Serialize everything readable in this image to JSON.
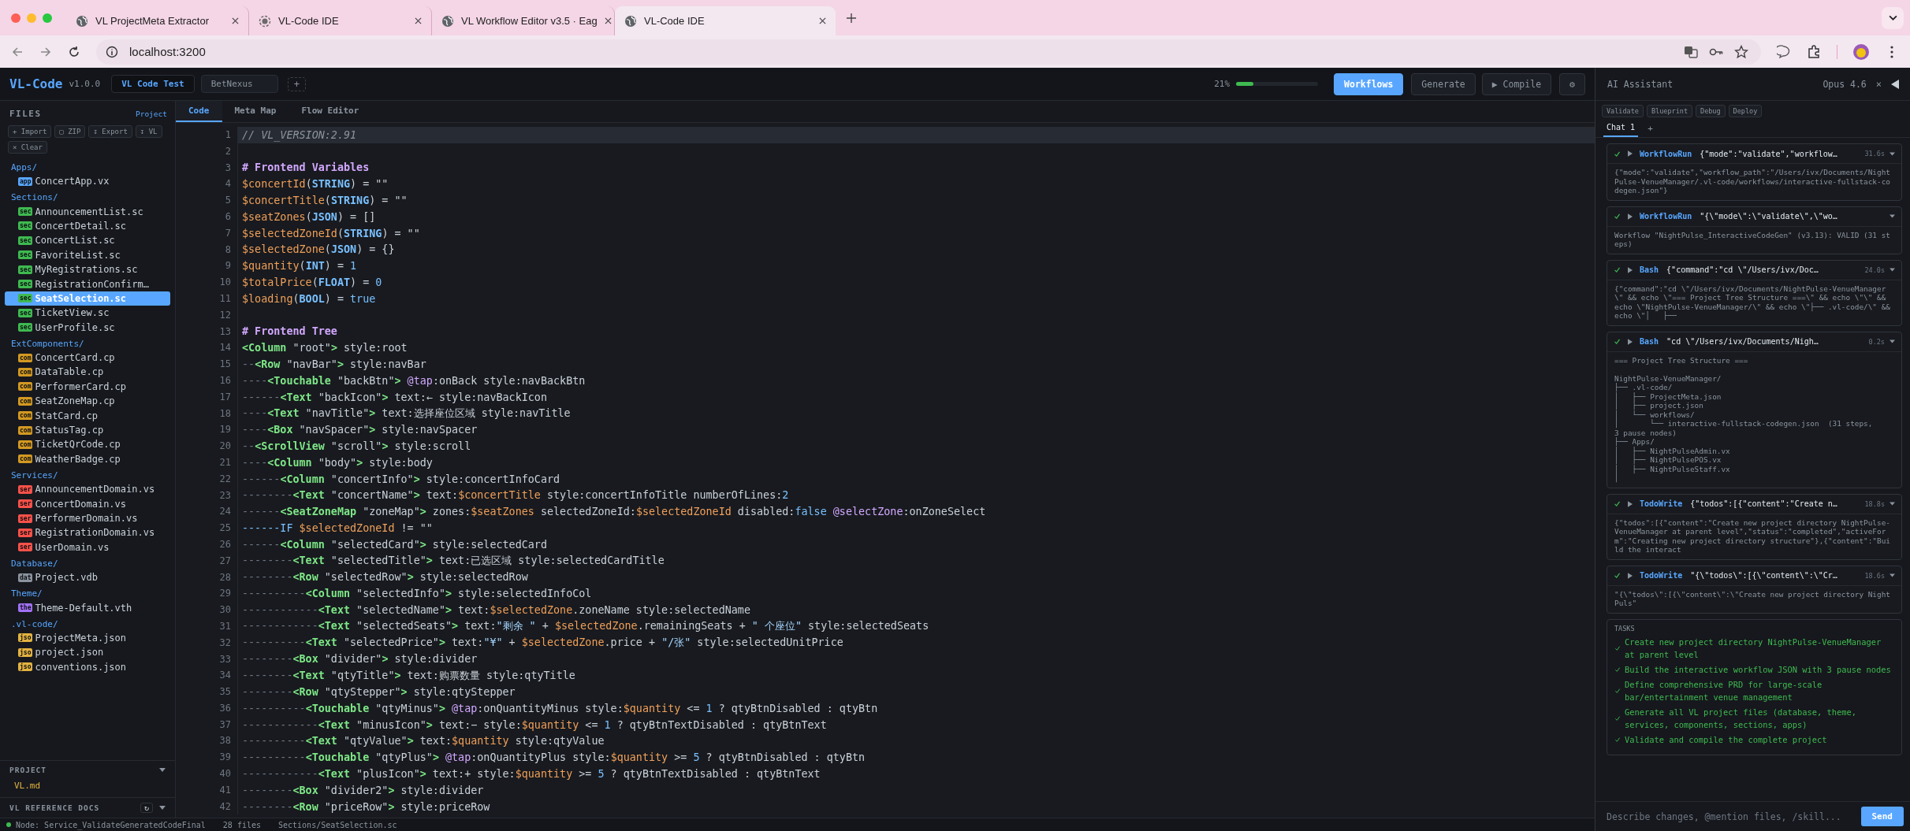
{
  "browser": {
    "tabs": [
      {
        "title": "VL ProjectMeta Extractor",
        "loading": false,
        "selected": false
      },
      {
        "title": "VL-Code IDE",
        "loading": true,
        "selected": false
      },
      {
        "title": "VL Workflow Editor v3.5 · Eag",
        "loading": false,
        "selected": false
      },
      {
        "title": "VL-Code IDE",
        "loading": false,
        "selected": true
      }
    ],
    "address": "localhost:3200"
  },
  "header": {
    "logo": "VL-Code",
    "version": "v1.0.0",
    "project_tabs": [
      {
        "label": "VL Code Test",
        "selected": true
      },
      {
        "label": "BetNexus",
        "selected": false
      }
    ],
    "add_project": "+",
    "progress": {
      "reading": "21%",
      "level": 0.21
    },
    "buttons": [
      {
        "label": "Workflows",
        "kind": "primary"
      },
      {
        "label": "Generate",
        "kind": "default"
      },
      {
        "label": "▶ Compile",
        "kind": "default"
      },
      {
        "label": "⚙",
        "kind": "icon"
      }
    ]
  },
  "sidebar": {
    "title": "FILES",
    "link": "Project",
    "actions": [
      "+ Import",
      "▢ ZIP",
      "↧ Export",
      "↧ VL",
      "× Clear"
    ],
    "folders": [
      {
        "name": "Apps/",
        "color": "#58a6ff",
        "files": [
          {
            "badge": "app",
            "name": "ConcertApp.vx",
            "selected": false
          }
        ]
      },
      {
        "name": "Sections/",
        "color": "#3fb950",
        "files": [
          {
            "badge": "sec",
            "name": "AnnouncementList.sc",
            "selected": false
          },
          {
            "badge": "sec",
            "name": "ConcertDetail.sc",
            "selected": false
          },
          {
            "badge": "sec",
            "name": "ConcertList.sc",
            "selected": false
          },
          {
            "badge": "sec",
            "name": "FavoriteList.sc",
            "selected": false
          },
          {
            "badge": "sec",
            "name": "MyRegistrations.sc",
            "selected": false
          },
          {
            "badge": "sec",
            "name": "RegistrationConfirm…",
            "selected": false
          },
          {
            "badge": "sec",
            "name": "SeatSelection.sc",
            "selected": true
          },
          {
            "badge": "sec",
            "name": "TicketView.sc",
            "selected": false
          },
          {
            "badge": "sec",
            "name": "UserProfile.sc",
            "selected": false
          }
        ]
      },
      {
        "name": "ExtComponents/",
        "color": "#d29922",
        "files": [
          {
            "badge": "com",
            "name": "ConcertCard.cp",
            "selected": false
          },
          {
            "badge": "com",
            "name": "DataTable.cp",
            "selected": false
          },
          {
            "badge": "com",
            "name": "PerformerCard.cp",
            "selected": false
          },
          {
            "badge": "com",
            "name": "SeatZoneMap.cp",
            "selected": false
          },
          {
            "badge": "com",
            "name": "StatCard.cp",
            "selected": false
          },
          {
            "badge": "com",
            "name": "StatusTag.cp",
            "selected": false
          },
          {
            "badge": "com",
            "name": "TicketQrCode.cp",
            "selected": false
          },
          {
            "badge": "com",
            "name": "WeatherBadge.cp",
            "selected": false
          }
        ]
      },
      {
        "name": "Services/",
        "color": "#f85149",
        "files": [
          {
            "badge": "ser",
            "name": "AnnouncementDomain.vs",
            "selected": false
          },
          {
            "badge": "ser",
            "name": "ConcertDomain.vs",
            "selected": false
          },
          {
            "badge": "ser",
            "name": "PerformerDomain.vs",
            "selected": false
          },
          {
            "badge": "ser",
            "name": "RegistrationDomain.vs",
            "selected": false
          },
          {
            "badge": "ser",
            "name": "UserDomain.vs",
            "selected": false
          }
        ]
      },
      {
        "name": "Database/",
        "color": "#8b949e",
        "files": [
          {
            "badge": "dat",
            "name": "Project.vdb",
            "selected": false
          }
        ]
      },
      {
        "name": "Theme/",
        "color": "#a371f7",
        "files": [
          {
            "badge": "the",
            "name": "Theme-Default.vth",
            "selected": false
          }
        ]
      },
      {
        "name": ".vl-code/",
        "color": "#e3b341",
        "files": [
          {
            "badge": "jso",
            "name": "ProjectMeta.json",
            "selected": false
          },
          {
            "badge": "jso",
            "name": "project.json",
            "selected": false
          },
          {
            "badge": "jso",
            "name": "conventions.json",
            "selected": false
          }
        ]
      }
    ],
    "project_section": {
      "title": "PROJECT",
      "files": [
        "VL.md"
      ]
    },
    "reference_docs": {
      "title": "VL REFERENCE DOCS",
      "refresh": "↻"
    }
  },
  "editor": {
    "tabs": [
      {
        "label": "Code",
        "selected": true
      },
      {
        "label": "Meta Map",
        "selected": false
      },
      {
        "label": "Flow Editor",
        "selected": false
      }
    ],
    "lines": [
      {
        "number": "1",
        "current": true,
        "tokens": [
          {
            "kind": "comment",
            "text": "// VL_VERSION:2.91"
          }
        ]
      },
      {
        "number": "2",
        "current": false
      },
      {
        "number": "3",
        "current": false,
        "tokens": [
          {
            "kind": "heading",
            "text": "# Frontend Variables"
          }
        ]
      },
      {
        "number": "4",
        "current": false,
        "tokens": [
          {
            "kind": "var",
            "text": "$concertId"
          },
          {
            "kind": "plain",
            "text": "("
          },
          {
            "kind": "type",
            "text": "STRING"
          },
          {
            "kind": "plain",
            "text": ") = \"\""
          }
        ]
      },
      {
        "number": "5",
        "current": false,
        "tokens": [
          {
            "kind": "var",
            "text": "$concertTitle"
          },
          {
            "kind": "plain",
            "text": "("
          },
          {
            "kind": "type",
            "text": "STRING"
          },
          {
            "kind": "plain",
            "text": ") = \"\""
          }
        ]
      },
      {
        "number": "6",
        "current": false,
        "tokens": [
          {
            "kind": "var",
            "text": "$seatZones"
          },
          {
            "kind": "plain",
            "text": "("
          },
          {
            "kind": "type",
            "text": "JSON"
          },
          {
            "kind": "plain",
            "text": ") = []"
          }
        ]
      },
      {
        "number": "7",
        "current": false,
        "tokens": [
          {
            "kind": "var",
            "text": "$selectedZoneId"
          },
          {
            "kind": "plain",
            "text": "("
          },
          {
            "kind": "type",
            "text": "STRING"
          },
          {
            "kind": "plain",
            "text": ") = \"\""
          }
        ]
      },
      {
        "number": "8",
        "current": false,
        "tokens": [
          {
            "kind": "var",
            "text": "$selectedZone"
          },
          {
            "kind": "plain",
            "text": "("
          },
          {
            "kind": "type",
            "text": "JSON"
          },
          {
            "kind": "plain",
            "text": ") = {}"
          }
        ]
      },
      {
        "number": "9",
        "current": false,
        "tokens": [
          {
            "kind": "var",
            "text": "$quantity"
          },
          {
            "kind": "plain",
            "text": "("
          },
          {
            "kind": "type",
            "text": "INT"
          },
          {
            "kind": "plain",
            "text": ") = "
          },
          {
            "kind": "num",
            "text": "1"
          }
        ]
      },
      {
        "number": "10",
        "current": false,
        "tokens": [
          {
            "kind": "var",
            "text": "$totalPrice"
          },
          {
            "kind": "plain",
            "text": "("
          },
          {
            "kind": "type",
            "text": "FLOAT"
          },
          {
            "kind": "plain",
            "text": ") = "
          },
          {
            "kind": "num",
            "text": "0"
          }
        ]
      },
      {
        "number": "11",
        "current": false,
        "tokens": [
          {
            "kind": "var",
            "text": "$loading"
          },
          {
            "kind": "plain",
            "text": "("
          },
          {
            "kind": "type",
            "text": "BOOL"
          },
          {
            "kind": "plain",
            "text": ") = "
          },
          {
            "kind": "num",
            "text": "true"
          }
        ]
      },
      {
        "number": "12",
        "current": false
      },
      {
        "number": "13",
        "current": false,
        "tokens": [
          {
            "kind": "heading",
            "text": "# Frontend Tree"
          }
        ]
      },
      {
        "number": "14",
        "current": false,
        "tokens": [
          {
            "kind": "tag",
            "text": "<Column"
          },
          {
            "kind": "plain",
            "text": " \"root\""
          },
          {
            "kind": "tag",
            "text": ">"
          },
          {
            "kind": "plain",
            "text": " style:root"
          }
        ]
      },
      {
        "number": "15",
        "current": false,
        "tokens": [
          {
            "kind": "dash",
            "text": "--"
          },
          {
            "kind": "tag",
            "text": "<Row"
          },
          {
            "kind": "plain",
            "text": " \"navBar\""
          },
          {
            "kind": "tag",
            "text": ">"
          },
          {
            "kind": "plain",
            "text": " style:navBar"
          }
        ]
      },
      {
        "number": "16",
        "current": false,
        "tokens": [
          {
            "kind": "dash",
            "text": "----"
          },
          {
            "kind": "tag",
            "text": "<Touchable"
          },
          {
            "kind": "plain",
            "text": " \"backBtn\""
          },
          {
            "kind": "tag",
            "text": ">"
          },
          {
            "kind": "event",
            "text": " @tap"
          },
          {
            "kind": "plain",
            "text": ":onBack style:navBackBtn"
          }
        ]
      },
      {
        "number": "17",
        "current": false,
        "tokens": [
          {
            "kind": "dash",
            "text": "------"
          },
          {
            "kind": "tag",
            "text": "<Text"
          },
          {
            "kind": "plain",
            "text": " \"backIcon\""
          },
          {
            "kind": "tag",
            "text": ">"
          },
          {
            "kind": "plain",
            "text": " text:← style:navBackIcon"
          }
        ]
      },
      {
        "number": "18",
        "current": false,
        "tokens": [
          {
            "kind": "dash",
            "text": "----"
          },
          {
            "kind": "tag",
            "text": "<Text"
          },
          {
            "kind": "plain",
            "text": " \"navTitle\""
          },
          {
            "kind": "tag",
            "text": ">"
          },
          {
            "kind": "plain",
            "text": " text:选择座位区域 style:navTitle"
          }
        ]
      },
      {
        "number": "19",
        "current": false,
        "tokens": [
          {
            "kind": "dash",
            "text": "----"
          },
          {
            "kind": "tag",
            "text": "<Box"
          },
          {
            "kind": "plain",
            "text": " \"navSpacer\""
          },
          {
            "kind": "tag",
            "text": ">"
          },
          {
            "kind": "plain",
            "text": " style:navSpacer"
          }
        ]
      },
      {
        "number": "20",
        "current": false,
        "tokens": [
          {
            "kind": "dash",
            "text": "--"
          },
          {
            "kind": "tag",
            "text": "<ScrollView"
          },
          {
            "kind": "plain",
            "text": " \"scroll\""
          },
          {
            "kind": "tag",
            "text": ">"
          },
          {
            "kind": "plain",
            "text": " style:scroll"
          }
        ]
      },
      {
        "number": "21",
        "current": false,
        "tokens": [
          {
            "kind": "dash",
            "text": "----"
          },
          {
            "kind": "tag",
            "text": "<Column"
          },
          {
            "kind": "plain",
            "text": " \"body\""
          },
          {
            "kind": "tag",
            "text": ">"
          },
          {
            "kind": "plain",
            "text": " style:body"
          }
        ]
      },
      {
        "number": "22",
        "current": false,
        "tokens": [
          {
            "kind": "dash",
            "text": "------"
          },
          {
            "kind": "tag",
            "text": "<Column"
          },
          {
            "kind": "plain",
            "text": " \"concertInfo\""
          },
          {
            "kind": "tag",
            "text": ">"
          },
          {
            "kind": "plain",
            "text": " style:concertInfoCard"
          }
        ]
      },
      {
        "number": "23",
        "current": false,
        "tokens": [
          {
            "kind": "dash",
            "text": "--------"
          },
          {
            "kind": "tag",
            "text": "<Text"
          },
          {
            "kind": "plain",
            "text": " \"concertName\""
          },
          {
            "kind": "tag",
            "text": ">"
          },
          {
            "kind": "plain",
            "text": " text:"
          },
          {
            "kind": "var",
            "text": "$concertTitle"
          },
          {
            "kind": "plain",
            "text": " style:concertInfoTitle numberOfLines:"
          },
          {
            "kind": "num",
            "text": "2"
          }
        ]
      },
      {
        "number": "24",
        "current": false,
        "tokens": [
          {
            "kind": "dash",
            "text": "------"
          },
          {
            "kind": "tag",
            "text": "<SeatZoneMap"
          },
          {
            "kind": "plain",
            "text": " \"zoneMap\""
          },
          {
            "kind": "tag",
            "text": ">"
          },
          {
            "kind": "plain",
            "text": " zones:"
          },
          {
            "kind": "var",
            "text": "$seatZones"
          },
          {
            "kind": "plain",
            "text": " selectedZoneId:"
          },
          {
            "kind": "var",
            "text": "$selectedZoneId"
          },
          {
            "kind": "plain",
            "text": " disabled:"
          },
          {
            "kind": "num",
            "text": "false"
          },
          {
            "kind": "event",
            "text": " @selectZone"
          },
          {
            "kind": "plain",
            "text": ":onZoneSelect"
          }
        ]
      },
      {
        "number": "25",
        "current": false,
        "tokens": [
          {
            "kind": "keyword",
            "text": "------IF"
          },
          {
            "kind": "var",
            "text": " $selectedZoneId"
          },
          {
            "kind": "plain",
            "text": " != \"\""
          }
        ]
      },
      {
        "number": "26",
        "current": false,
        "tokens": [
          {
            "kind": "dash",
            "text": "------"
          },
          {
            "kind": "tag",
            "text": "<Column"
          },
          {
            "kind": "plain",
            "text": " \"selectedCard\""
          },
          {
            "kind": "tag",
            "text": ">"
          },
          {
            "kind": "plain",
            "text": " style:selectedCard"
          }
        ]
      },
      {
        "number": "27",
        "current": false,
        "tokens": [
          {
            "kind": "dash",
            "text": "--------"
          },
          {
            "kind": "tag",
            "text": "<Text"
          },
          {
            "kind": "plain",
            "text": " \"selectedTitle\""
          },
          {
            "kind": "tag",
            "text": ">"
          },
          {
            "kind": "plain",
            "text": " text:已选区域 style:selectedCardTitle"
          }
        ]
      },
      {
        "number": "28",
        "current": false,
        "tokens": [
          {
            "kind": "dash",
            "text": "--------"
          },
          {
            "kind": "tag",
            "text": "<Row"
          },
          {
            "kind": "plain",
            "text": " \"selectedRow\""
          },
          {
            "kind": "tag",
            "text": ">"
          },
          {
            "kind": "plain",
            "text": " style:selectedRow"
          }
        ]
      },
      {
        "number": "29",
        "current": false,
        "tokens": [
          {
            "kind": "dash",
            "text": "----------"
          },
          {
            "kind": "tag",
            "text": "<Column"
          },
          {
            "kind": "plain",
            "text": " \"selectedInfo\""
          },
          {
            "kind": "tag",
            "text": ">"
          },
          {
            "kind": "plain",
            "text": " style:selectedInfoCol"
          }
        ]
      },
      {
        "number": "30",
        "current": false,
        "tokens": [
          {
            "kind": "dash",
            "text": "------------"
          },
          {
            "kind": "tag",
            "text": "<Text"
          },
          {
            "kind": "plain",
            "text": " \"selectedName\""
          },
          {
            "kind": "tag",
            "text": ">"
          },
          {
            "kind": "plain",
            "text": " text:"
          },
          {
            "kind": "var",
            "text": "$selectedZone"
          },
          {
            "kind": "plain",
            "text": ".zoneName style:selectedName"
          }
        ]
      },
      {
        "number": "31",
        "current": false,
        "tokens": [
          {
            "kind": "dash",
            "text": "------------"
          },
          {
            "kind": "tag",
            "text": "<Text"
          },
          {
            "kind": "plain",
            "text": " \"selectedSeats\""
          },
          {
            "kind": "tag",
            "text": ">"
          },
          {
            "kind": "plain",
            "text": " text:"
          },
          {
            "kind": "str",
            "text": "\"剩余 \""
          },
          {
            "kind": "plain",
            "text": " + "
          },
          {
            "kind": "var",
            "text": "$selectedZone"
          },
          {
            "kind": "plain",
            "text": ".remainingSeats + "
          },
          {
            "kind": "str",
            "text": "\" 个座位\""
          },
          {
            "kind": "plain",
            "text": " style:selectedSeats"
          }
        ]
      },
      {
        "number": "32",
        "current": false,
        "tokens": [
          {
            "kind": "dash",
            "text": "----------"
          },
          {
            "kind": "tag",
            "text": "<Text"
          },
          {
            "kind": "plain",
            "text": " \"selectedPrice\""
          },
          {
            "kind": "tag",
            "text": ">"
          },
          {
            "kind": "plain",
            "text": " text:"
          },
          {
            "kind": "str",
            "text": "\"¥\""
          },
          {
            "kind": "plain",
            "text": " + "
          },
          {
            "kind": "var",
            "text": "$selectedZone"
          },
          {
            "kind": "plain",
            "text": ".price + "
          },
          {
            "kind": "str",
            "text": "\"/张\""
          },
          {
            "kind": "plain",
            "text": " style:selectedUnitPrice"
          }
        ]
      },
      {
        "number": "33",
        "current": false,
        "tokens": [
          {
            "kind": "dash",
            "text": "--------"
          },
          {
            "kind": "tag",
            "text": "<Box"
          },
          {
            "kind": "plain",
            "text": " \"divider\""
          },
          {
            "kind": "tag",
            "text": ">"
          },
          {
            "kind": "plain",
            "text": " style:divider"
          }
        ]
      },
      {
        "number": "34",
        "current": false,
        "tokens": [
          {
            "kind": "dash",
            "text": "--------"
          },
          {
            "kind": "tag",
            "text": "<Text"
          },
          {
            "kind": "plain",
            "text": " \"qtyTitle\""
          },
          {
            "kind": "tag",
            "text": ">"
          },
          {
            "kind": "plain",
            "text": " text:购票数量 style:qtyTitle"
          }
        ]
      },
      {
        "number": "35",
        "current": false,
        "tokens": [
          {
            "kind": "dash",
            "text": "--------"
          },
          {
            "kind": "tag",
            "text": "<Row"
          },
          {
            "kind": "plain",
            "text": " \"qtyStepper\""
          },
          {
            "kind": "tag",
            "text": ">"
          },
          {
            "kind": "plain",
            "text": " style:qtyStepper"
          }
        ]
      },
      {
        "number": "36",
        "current": false,
        "tokens": [
          {
            "kind": "dash",
            "text": "----------"
          },
          {
            "kind": "tag",
            "text": "<Touchable"
          },
          {
            "kind": "plain",
            "text": " \"qtyMinus\""
          },
          {
            "kind": "tag",
            "text": ">"
          },
          {
            "kind": "event",
            "text": " @tap"
          },
          {
            "kind": "plain",
            "text": ":onQuantityMinus style:"
          },
          {
            "kind": "var",
            "text": "$quantity"
          },
          {
            "kind": "plain",
            "text": " <= "
          },
          {
            "kind": "num",
            "text": "1"
          },
          {
            "kind": "plain",
            "text": " ? qtyBtnDisabled : qtyBtn"
          }
        ]
      },
      {
        "number": "37",
        "current": false,
        "tokens": [
          {
            "kind": "dash",
            "text": "------------"
          },
          {
            "kind": "tag",
            "text": "<Text"
          },
          {
            "kind": "plain",
            "text": " \"minusIcon\""
          },
          {
            "kind": "tag",
            "text": ">"
          },
          {
            "kind": "plain",
            "text": " text:− style:"
          },
          {
            "kind": "var",
            "text": "$quantity"
          },
          {
            "kind": "plain",
            "text": " <= "
          },
          {
            "kind": "num",
            "text": "1"
          },
          {
            "kind": "plain",
            "text": " ? qtyBtnTextDisabled : qtyBtnText"
          }
        ]
      },
      {
        "number": "38",
        "current": false,
        "tokens": [
          {
            "kind": "dash",
            "text": "----------"
          },
          {
            "kind": "tag",
            "text": "<Text"
          },
          {
            "kind": "plain",
            "text": " \"qtyValue\""
          },
          {
            "kind": "tag",
            "text": ">"
          },
          {
            "kind": "plain",
            "text": " text:"
          },
          {
            "kind": "var",
            "text": "$quantity"
          },
          {
            "kind": "plain",
            "text": " style:qtyValue"
          }
        ]
      },
      {
        "number": "39",
        "current": false,
        "tokens": [
          {
            "kind": "dash",
            "text": "----------"
          },
          {
            "kind": "tag",
            "text": "<Touchable"
          },
          {
            "kind": "plain",
            "text": " \"qtyPlus\""
          },
          {
            "kind": "tag",
            "text": ">"
          },
          {
            "kind": "event",
            "text": " @tap"
          },
          {
            "kind": "plain",
            "text": ":onQuantityPlus style:"
          },
          {
            "kind": "var",
            "text": "$quantity"
          },
          {
            "kind": "plain",
            "text": " >= "
          },
          {
            "kind": "num",
            "text": "5"
          },
          {
            "kind": "plain",
            "text": " ? qtyBtnDisabled : qtyBtn"
          }
        ]
      },
      {
        "number": "40",
        "current": false,
        "tokens": [
          {
            "kind": "dash",
            "text": "------------"
          },
          {
            "kind": "tag",
            "text": "<Text"
          },
          {
            "kind": "plain",
            "text": " \"plusIcon\""
          },
          {
            "kind": "tag",
            "text": ">"
          },
          {
            "kind": "plain",
            "text": " text:+ style:"
          },
          {
            "kind": "var",
            "text": "$quantity"
          },
          {
            "kind": "plain",
            "text": " >= "
          },
          {
            "kind": "num",
            "text": "5"
          },
          {
            "kind": "plain",
            "text": " ? qtyBtnTextDisabled : qtyBtnText"
          }
        ]
      },
      {
        "number": "41",
        "current": false,
        "tokens": [
          {
            "kind": "dash",
            "text": "--------"
          },
          {
            "kind": "tag",
            "text": "<Box"
          },
          {
            "kind": "plain",
            "text": " \"divider2\""
          },
          {
            "kind": "tag",
            "text": ">"
          },
          {
            "kind": "plain",
            "text": " style:divider"
          }
        ]
      },
      {
        "number": "42",
        "current": false,
        "tokens": [
          {
            "kind": "dash",
            "text": "--------"
          },
          {
            "kind": "tag",
            "text": "<Row"
          },
          {
            "kind": "plain",
            "text": " \"priceRow\""
          },
          {
            "kind": "tag",
            "text": ">"
          },
          {
            "kind": "plain",
            "text": " style:priceRow"
          }
        ]
      }
    ]
  },
  "status_bar": {
    "node": "Node: Service_ValidateGeneratedCodeFinal",
    "files": "28 files",
    "path": "Sections/SeatSelection.sc"
  },
  "assistant": {
    "title": "AI Assistant",
    "model": "Opus 4.6",
    "close": "×",
    "actions": [
      "Validate",
      "Blueprint",
      "Debug",
      "Deploy"
    ],
    "chat_tabs": [
      {
        "label": "Chat 1",
        "selected": true
      }
    ],
    "add_chat": "+",
    "tool_calls": [
      {
        "succeeded": true,
        "tool": "WorkflowRun",
        "summary": "{\"mode\":\"validate\",\"workflow…",
        "time": "31.6s",
        "body": "{\"mode\":\"validate\",\"workflow_path\":\"/Users/ivx/Documents/NightPulse-VenueManager/.vl-code/workflows/interactive-fullstack-codegen.json\"}"
      },
      {
        "succeeded": true,
        "tool": "WorkflowRun",
        "summary": "\"{\\\"mode\\\":\\\"validate\\\",\\\"wo…",
        "body": "Workflow \"NightPulse_InteractiveCodeGen\" (v3.13): VALID (31 steps)"
      },
      {
        "succeeded": true,
        "tool": "Bash",
        "summary": "{\"command\":\"cd \\\"/Users/ivx/Doc…",
        "time": "24.0s",
        "body": "{\"command\":\"cd \\\"/Users/ivx/Documents/NightPulse-VenueManager\\\" && echo \\\"=== Project Tree Structure ===\\\" && echo \\\"\\\" && echo \\\"NightPulse-VenueManager/\\\" && echo \\\"├── .vl-code/\\\" && echo \\\"│   ├──"
      },
      {
        "succeeded": true,
        "tool": "Bash",
        "summary": "\"cd \\\"/Users/ivx/Documents/Nigh…",
        "time": "0.2s",
        "body": "=== Project Tree Structure ===\n\nNightPulse-VenueManager/\n├── .vl-code/\n│   ├── ProjectMeta.json\n│   ├── project.json\n│   └── workflows/\n│       └── interactive-fullstack-codegen.json  (31 steps,\n3 pause nodes)\n├── Apps/\n│   ├── NightPulseAdmin.vx\n│   ├── NightPulsePOS.vx\n│   ├── NightPulseStaff.vx\n│"
      },
      {
        "succeeded": true,
        "tool": "TodoWrite",
        "summary": "{\"todos\":[{\"content\":\"Create n…",
        "time": "18.8s",
        "body": "{\"todos\":[{\"content\":\"Create new project directory NightPulse-VenueManager at parent level\",\"status\":\"completed\",\"activeForm\":\"Creating new project directory structure\"},{\"content\":\"Build the interact"
      },
      {
        "succeeded": true,
        "tool": "TodoWrite",
        "summary": "\"{\\\"todos\\\":[{\\\"content\\\":\\\"Cr…",
        "time": "18.6s",
        "body": "\"{\\\"todos\\\":[{\\\"content\\\":\\\"Create new project directory NightPuls\""
      }
    ],
    "tasks": {
      "title": "TASKS",
      "items": [
        {
          "text": "Create new project directory NightPulse-VenueManager at parent level",
          "done": true
        },
        {
          "text": "Build the interactive workflow JSON with 3 pause nodes",
          "done": true
        },
        {
          "text": "Define comprehensive PRD for large-scale bar/entertainment venue management",
          "done": true
        },
        {
          "text": "Generate all VL project files (database, theme, services, components, sections, apps)",
          "done": true
        },
        {
          "text": "Validate and compile the complete project",
          "done": true
        }
      ]
    },
    "input": {
      "placeholder": "Describe changes, @mention files, /skill..."
    },
    "send": "Send"
  }
}
